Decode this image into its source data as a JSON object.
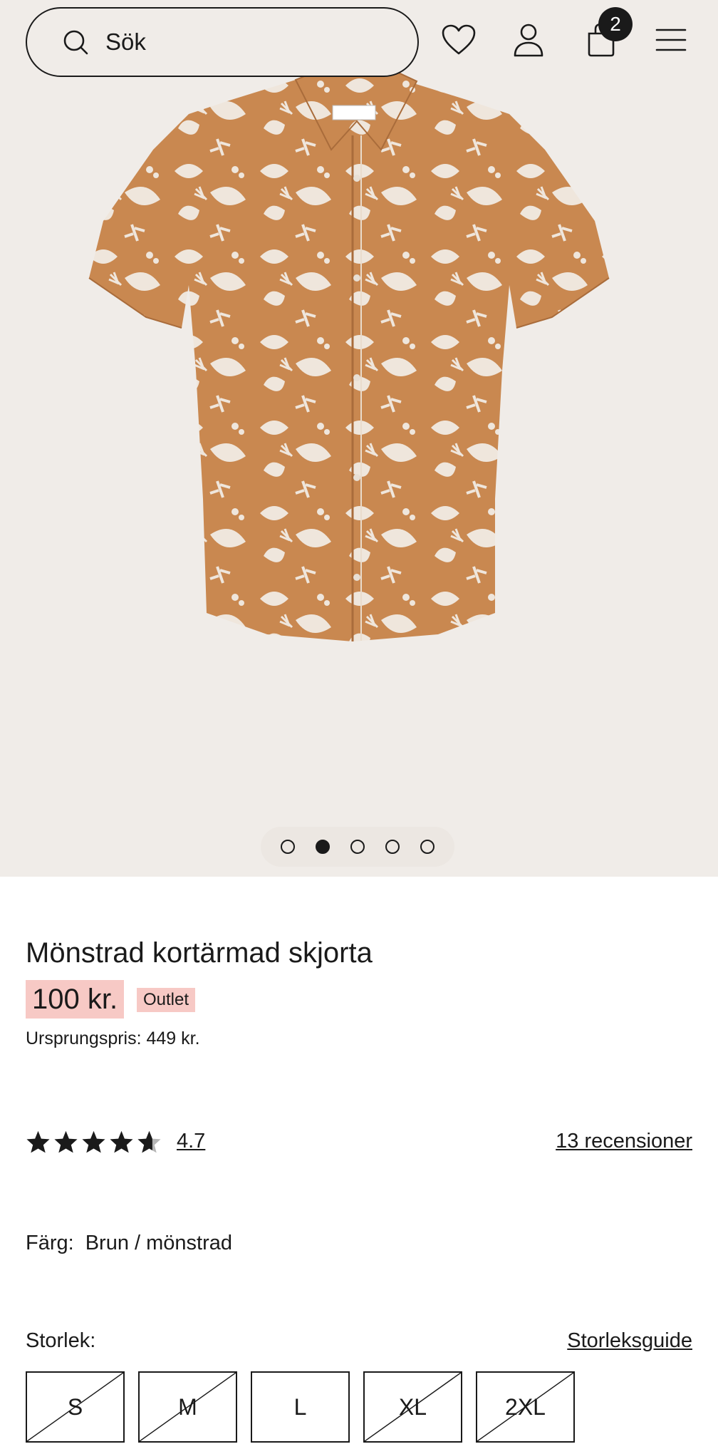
{
  "search": {
    "placeholder": "Sök"
  },
  "cart": {
    "count": "2"
  },
  "icons": {
    "search": "search-icon",
    "wishlist": "heart-icon",
    "account": "user-icon",
    "cart": "shopping-bag-icon",
    "menu": "hamburger-menu-icon"
  },
  "product": {
    "title": "Mönstrad kortärmad skjorta",
    "price": "100 kr.",
    "badge": "Outlet",
    "original_price": "Ursprungspris: 449 kr."
  },
  "gallery": {
    "total": 5,
    "active_index": 1
  },
  "rating": {
    "value": "4.7",
    "stars": 4.7,
    "reviews_label": "13 recensioner"
  },
  "color": {
    "label": "Färg:",
    "value": "Brun / mönstrad"
  },
  "size": {
    "label": "Storlek:",
    "guide_label": "Storleksguide",
    "options": [
      {
        "label": "S",
        "available": false
      },
      {
        "label": "M",
        "available": false
      },
      {
        "label": "L",
        "available": true
      },
      {
        "label": "XL",
        "available": false
      },
      {
        "label": "2XL",
        "available": false
      }
    ]
  },
  "colors": {
    "hero_bg": "#f0ece8",
    "shirt": "#c98850",
    "print": "#efe6dc",
    "sale_highlight": "#f7c9c5",
    "text": "#1a1a1a"
  }
}
